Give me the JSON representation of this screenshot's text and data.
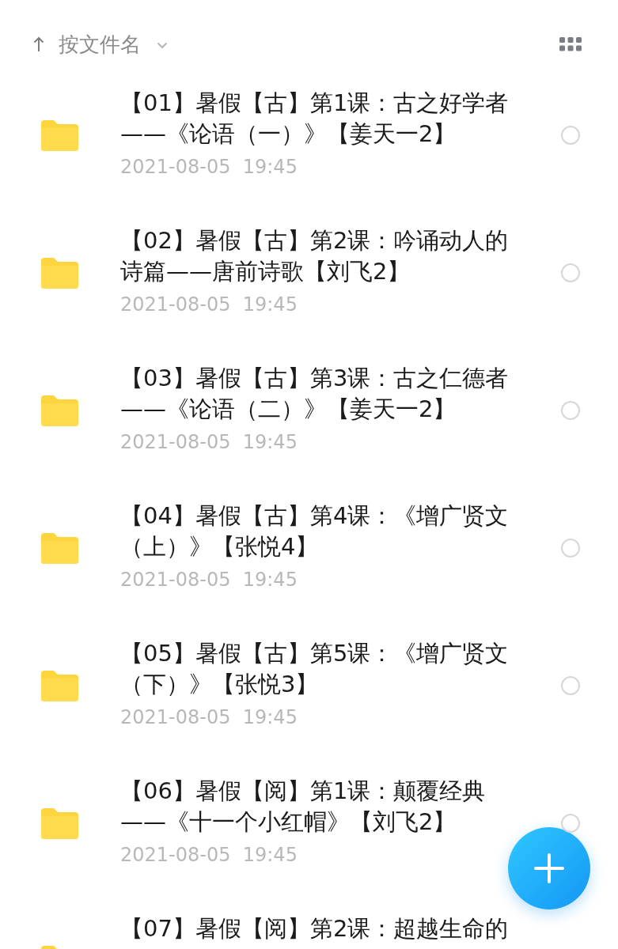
{
  "sort_bar": {
    "label": "按文件名"
  },
  "files": [
    {
      "name": "【01】暑假【古】第1课：古之好学者——《论语（一）》【姜天一2】",
      "date": "2021-08-05  19:45",
      "selected": false
    },
    {
      "name": "【02】暑假【古】第2课：吟诵动人的诗篇——唐前诗歌【刘飞2】",
      "date": "2021-08-05  19:45",
      "selected": false
    },
    {
      "name": "【03】暑假【古】第3课：古之仁德者——《论语（二）》【姜天一2】",
      "date": "2021-08-05  19:45",
      "selected": false
    },
    {
      "name": "【04】暑假【古】第4课：《增广贤文（上）》【张悦4】",
      "date": "2021-08-05  19:45",
      "selected": false
    },
    {
      "name": "【05】暑假【古】第5课：《增广贤文（下）》【张悦3】",
      "date": "2021-08-05  19:45",
      "selected": false
    },
    {
      "name": "【06】暑假【阅】第1课：颠覆经典——《十一个小红帽》【刘飞2】",
      "date": "2021-08-05  19:45",
      "selected": false
    },
    {
      "name": "【07】暑假【阅】第2课：超越生命的"
    }
  ]
}
